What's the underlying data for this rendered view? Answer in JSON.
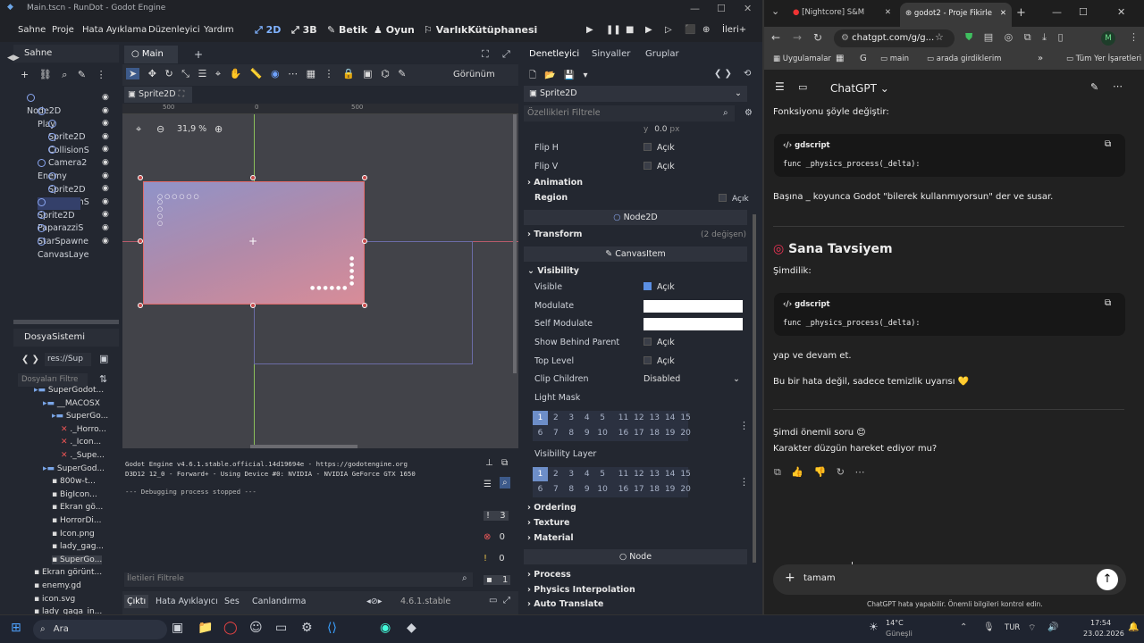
{
  "godot": {
    "title": "Main.tscn - RunDot - Godot Engine",
    "menu": [
      "Sahne",
      "Proje",
      "Hata Ayıklama",
      "Düzenleyici",
      "Yardım"
    ],
    "workspaces": [
      "2D",
      "3B",
      "Betik",
      "Oyun",
      "VarlıkKütüphanesi"
    ],
    "renderer": "İleri+",
    "scene_dock": {
      "title": "Sahne",
      "nodes": [
        {
          "name": "Node2D",
          "level": 0
        },
        {
          "name": "Play",
          "level": 1
        },
        {
          "name": "Sprite2D",
          "level": 2
        },
        {
          "name": "CollisionS",
          "level": 2
        },
        {
          "name": "Camera2",
          "level": 2
        },
        {
          "name": "Enemy",
          "level": 1
        },
        {
          "name": "Sprite2D",
          "level": 2
        },
        {
          "name": "CollisionS",
          "level": 2
        },
        {
          "name": "Sprite2D",
          "level": 1
        },
        {
          "name": "PaparazziS",
          "level": 1
        },
        {
          "name": "StarSpawne",
          "level": 1
        },
        {
          "name": "CanvasLaye",
          "level": 1
        }
      ]
    },
    "filesystem": {
      "title": "DosyaSistemi",
      "path": "res://Sup",
      "filter_placeholder": "Dosyaları Filtre",
      "items": [
        "SuperGodot...",
        "__MACOSX",
        "SuperGo...",
        "._Horro...",
        "._Icon...",
        "._Supe...",
        "SuperGod...",
        "800w-t...",
        "BigIcon...",
        "Ekran gö...",
        "HorrorDi...",
        "Icon.png",
        "lady_gag...",
        "SuperGo...",
        "Ekran görünt...",
        "enemy.gd",
        "icon.svg",
        "lady_gaga_in..."
      ]
    },
    "viewport": {
      "tab": "Main",
      "node_tab": "Sprite2D",
      "zoom": "31,9 %",
      "view_menu": "Görünüm",
      "ruler": [
        "0",
        "500",
        "500"
      ]
    },
    "output": {
      "lines": [
        "Godot Engine v4.6.1.stable.official.14d19694e - https://godotengine.org",
        "D3D12 12_0 - Forward+ - Using Device #0: NVIDIA - NVIDIA GeForce GTX 1650",
        "",
        "--- Debugging process stopped ---"
      ],
      "filter_placeholder": "İletileri Filtrele",
      "counts": {
        "errors": "3",
        "warnings": "0",
        "info": "0",
        "other": "1"
      },
      "tabs": [
        "Çıktı",
        "Hata Ayıklayıcı",
        "Ses",
        "Canlandırma"
      ],
      "version": "4.6.1.stable"
    },
    "inspector": {
      "tabs": [
        "Denetleyici",
        "Sinyaller",
        "Gruplar"
      ],
      "node": "Sprite2D",
      "filter_placeholder": "Özellikleri Filtrele",
      "offset_y": "0.0",
      "offset_unit": "px",
      "on_label": "Açık",
      "props": {
        "flip_h": "Flip H",
        "flip_v": "Flip V",
        "animation": "Animation",
        "region": "Region",
        "node2d": "Node2D",
        "transform": "Transform",
        "transform_changes": "(2 değişen)",
        "canvasitem": "CanvasItem",
        "visibility": "Visibility",
        "visible": "Visible",
        "modulate": "Modulate",
        "self_modulate": "Self Modulate",
        "show_behind": "Show Behind Parent",
        "top_level": "Top Level",
        "clip_children": "Clip Children",
        "clip_value": "Disabled",
        "light_mask": "Light Mask",
        "visibility_layer": "Visibility Layer",
        "ordering": "Ordering",
        "texture": "Texture",
        "material": "Material",
        "node": "Node",
        "process": "Process",
        "physics_interp": "Physics Interpolation",
        "auto_translate": "Auto Translate"
      },
      "layers_row1": [
        "1",
        "2",
        "3",
        "4",
        "5",
        "11",
        "12",
        "13",
        "14",
        "15"
      ],
      "layers_row2": [
        "6",
        "7",
        "8",
        "9",
        "10",
        "16",
        "17",
        "18",
        "19",
        "20"
      ]
    }
  },
  "chrome": {
    "tabs": [
      "[Nightcore] S&M",
      "godot2 - Proje Fikirle"
    ],
    "url": "chatgpt.com/g/g...",
    "bookmarks": [
      "Uygulamalar",
      "main",
      "arada girdiklerim",
      "Tüm Yer İşaretleri"
    ],
    "profile": "M",
    "header": "ChatGPT",
    "messages": {
      "m1": "Fonksiyonu şöyle değiştir:",
      "code_lang": "gdscript",
      "code1": "func _physics_process(_delta):",
      "m2": "Başına _ koyunca Godot \"bilerek kullanmıyorsun\" der ve susar.",
      "h1": "Sana Tavsiyem",
      "m3": "Şimdilik:",
      "code2": "func _physics_process(_delta):",
      "m4": "yap ve devam et.",
      "m5": "Bu bir hata değil, sadece temizlik uyarısı 💛",
      "m6": "Şimdi önemli soru 😊",
      "m7": "Karakter düzgün hareket ediyor mu?"
    },
    "input_value": "tamam",
    "disclaimer": "ChatGPT hata yapabilir. Önemli bilgileri kontrol edin."
  },
  "taskbar": {
    "search": "Ara",
    "temp": "14°C",
    "weather": "Güneşli",
    "lang": "TUR",
    "time": "17:54",
    "date": "23.02.2026"
  }
}
